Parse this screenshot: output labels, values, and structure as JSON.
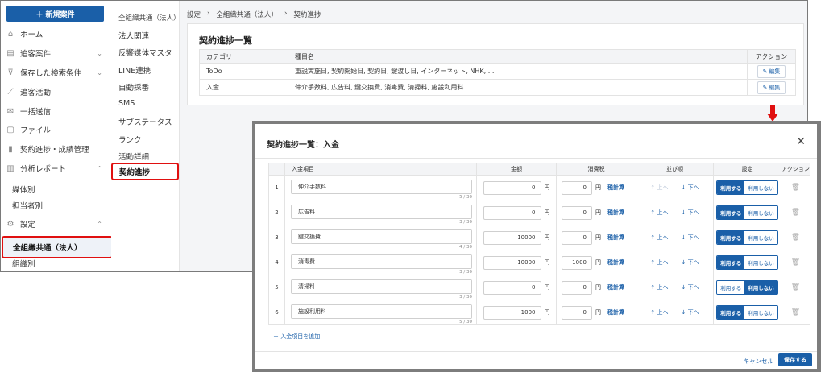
{
  "sidebar": {
    "new_button": "新規案件",
    "items": [
      {
        "label": "ホーム",
        "icon": "home-icon",
        "glyph": "⌂",
        "chevron": ""
      },
      {
        "label": "追客案件",
        "icon": "list-icon",
        "glyph": "▤",
        "chevron": "⌄"
      },
      {
        "label": "保存した検索条件",
        "icon": "filter-icon",
        "glyph": "⊽",
        "chevron": "⌄"
      },
      {
        "label": "追客活動",
        "icon": "activity-icon",
        "glyph": "⟋",
        "chevron": ""
      },
      {
        "label": "一括送信",
        "icon": "mail-icon",
        "glyph": "✉",
        "chevron": ""
      },
      {
        "label": "ファイル",
        "icon": "file-icon",
        "glyph": "▢",
        "chevron": ""
      },
      {
        "label": "契約進捗・成績管理",
        "icon": "bar-chart-icon",
        "glyph": "▮",
        "chevron": ""
      },
      {
        "label": "分析レポート",
        "icon": "report-icon",
        "glyph": "▥",
        "chevron": "⌃"
      }
    ],
    "report_subitems": [
      "媒体別",
      "担当者別"
    ],
    "settings": {
      "label": "設定",
      "icon": "gear-icon",
      "glyph": "⚙",
      "chevron": "⌃"
    },
    "active_item": "全組織共通（法人）",
    "below_active": "組織別"
  },
  "subnav": {
    "items": [
      "全組織共通（法人）",
      "法人関連",
      "反響媒体マスタ",
      "LINE連携",
      "自動採番",
      "SMS",
      "サブステータス",
      "ランク",
      "活動詳細"
    ],
    "active": "契約進捗"
  },
  "breadcrumb": [
    "設定",
    "全組織共通（法人）",
    "契約進捗"
  ],
  "contract_card": {
    "title": "契約進捗一覧",
    "headers": [
      "カテゴリ",
      "種目名",
      "アクション"
    ],
    "rows": [
      {
        "category": "ToDo",
        "items": "重説実施日, 契約開始日, 契約日, 鍵渡し日, インターネット, NHK, ..."
      },
      {
        "category": "入金",
        "items": "仲介手数料, 広告料, 鍵交換費, 消毒費, 清掃料, 施設利用料"
      }
    ],
    "edit_label": "編集"
  },
  "modal": {
    "title": "契約進捗一覧：入金",
    "headers": {
      "item": "入金項目",
      "amount": "金額",
      "tax": "消費税",
      "order": "並び順",
      "setting": "設定",
      "action": "アクション"
    },
    "yen": "円",
    "calc_label": "税計算",
    "up_label": "上へ",
    "down_label": "下へ",
    "use_label": "利用する",
    "nouse_label": "利用しない",
    "rows": [
      {
        "no": "1",
        "name": "仲介手数料",
        "count": "5 / 30",
        "amount": "0",
        "tax": "0",
        "in_use": true
      },
      {
        "no": "2",
        "name": "広告料",
        "count": "3 / 30",
        "amount": "0",
        "tax": "0",
        "in_use": true
      },
      {
        "no": "3",
        "name": "鍵交換費",
        "count": "4 / 30",
        "amount": "10000",
        "tax": "0",
        "in_use": true
      },
      {
        "no": "4",
        "name": "消毒費",
        "count": "3 / 30",
        "amount": "10000",
        "tax": "1000",
        "in_use": true
      },
      {
        "no": "5",
        "name": "清掃料",
        "count": "3 / 30",
        "amount": "0",
        "tax": "0",
        "in_use": false
      },
      {
        "no": "6",
        "name": "施設利用料",
        "count": "5 / 30",
        "amount": "1000",
        "tax": "0",
        "in_use": true
      }
    ],
    "add_label": "入金項目を追加",
    "cancel_label": "キャンセル",
    "save_label": "保存する"
  },
  "colors": {
    "accent": "#1a5fa8",
    "highlight": "#e01010"
  }
}
